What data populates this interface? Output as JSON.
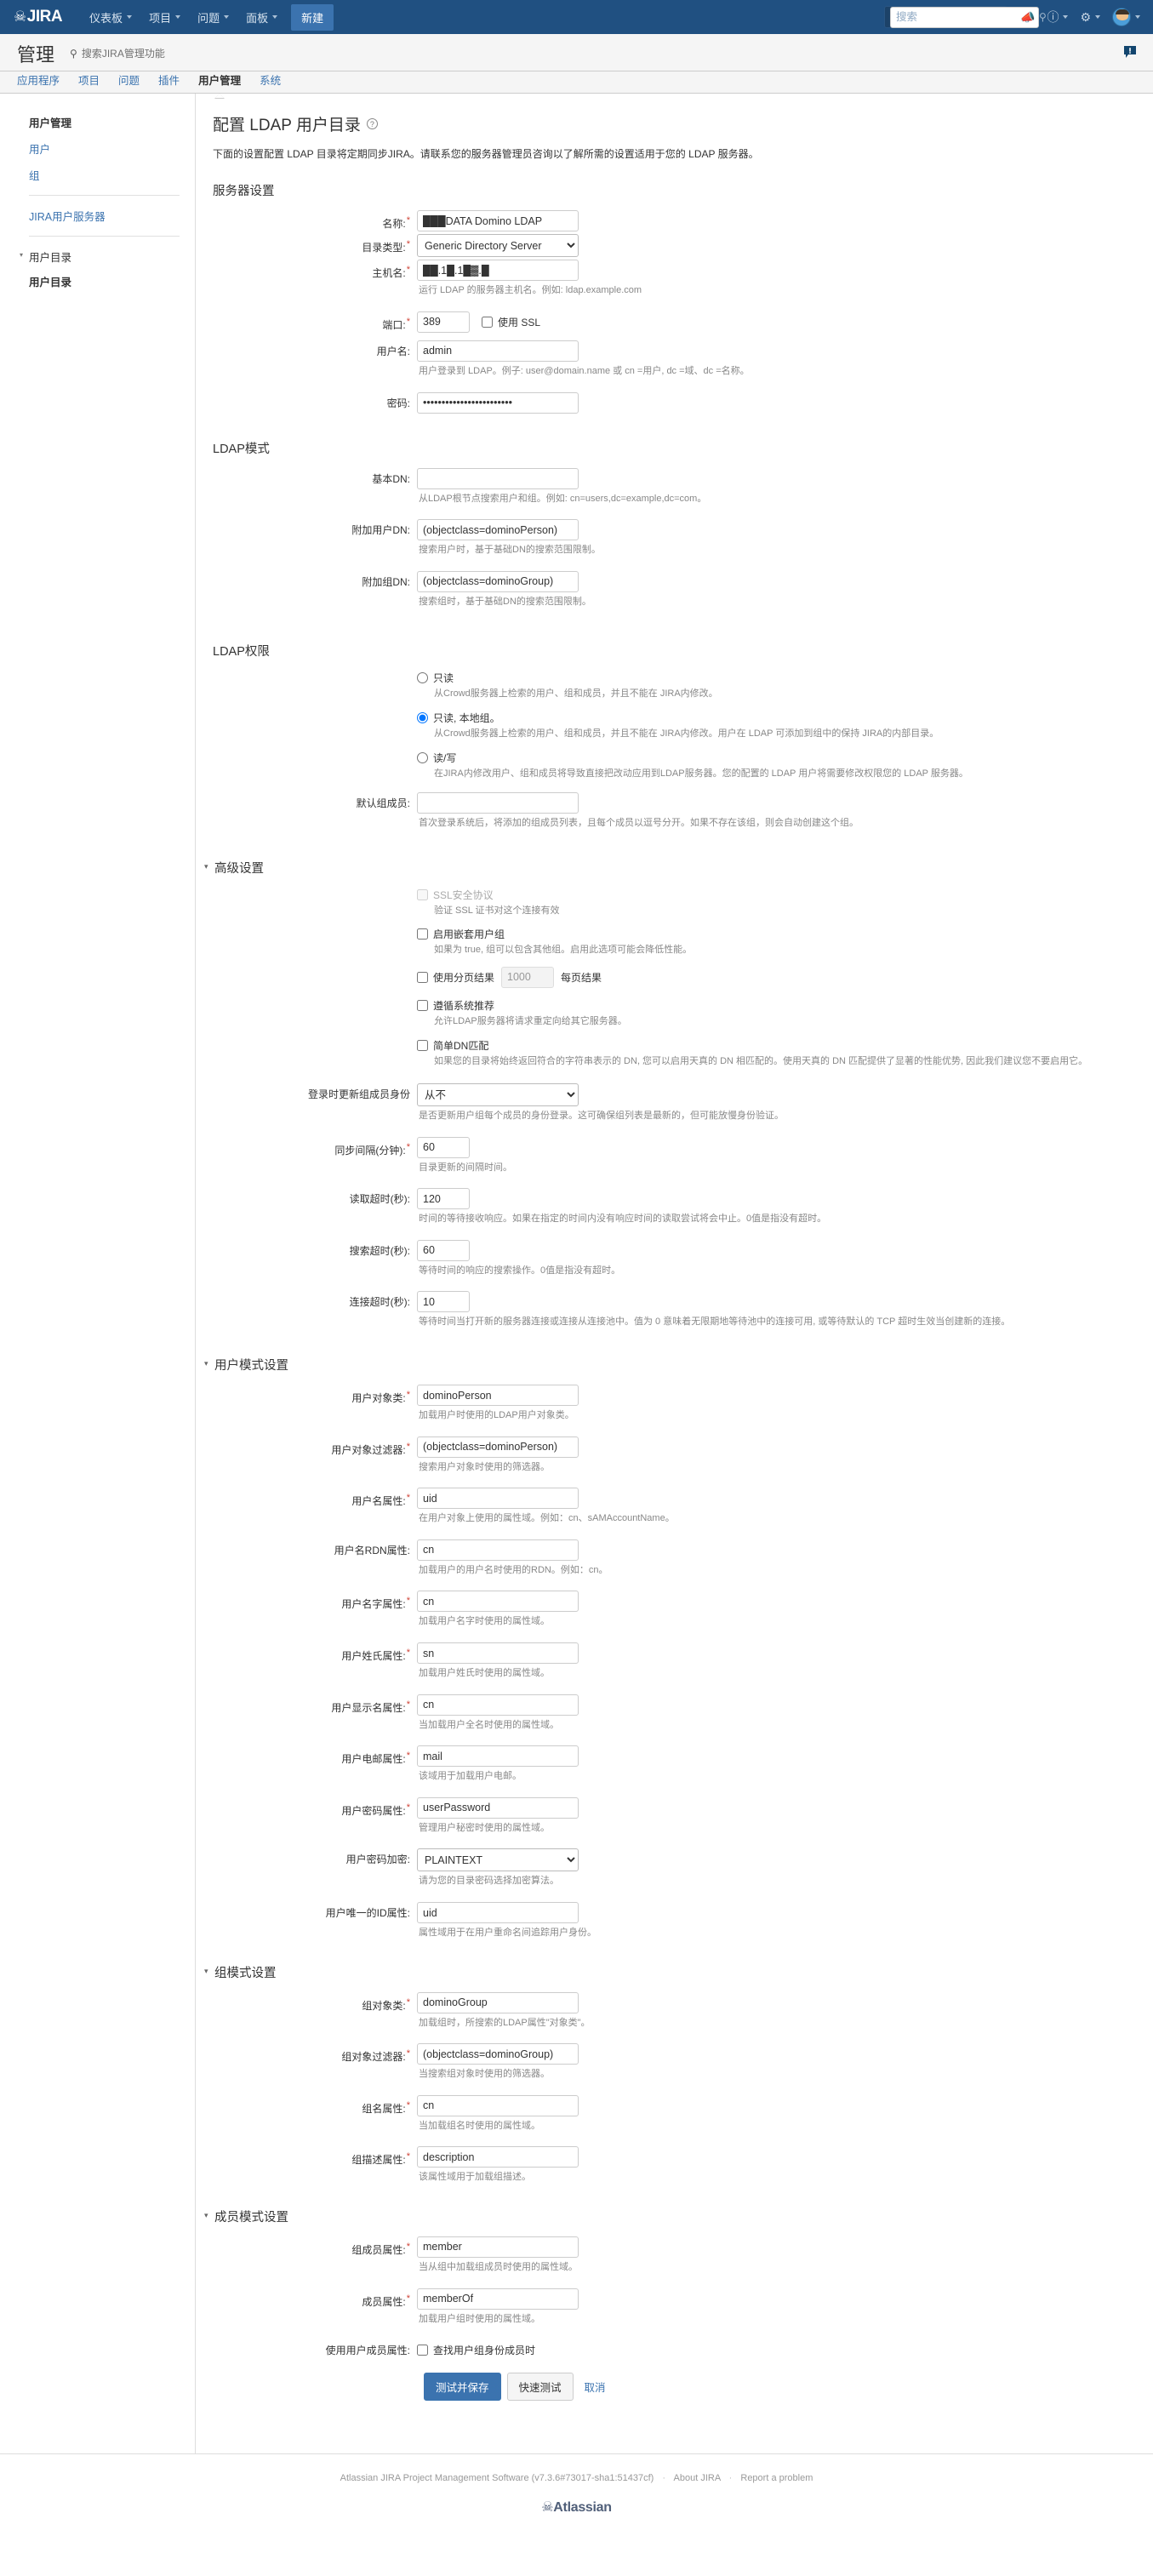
{
  "topnav": {
    "logo": "JIRA",
    "items": [
      {
        "label": "仪表板",
        "caret": true
      },
      {
        "label": "项目",
        "caret": true
      },
      {
        "label": "问题",
        "caret": true
      },
      {
        "label": "面板",
        "caret": true
      }
    ],
    "create_button": "新建",
    "search_placeholder": "搜索",
    "icons": [
      "megaphone-icon",
      "help-icon",
      "gear-icon",
      "avatar"
    ]
  },
  "admin_header": {
    "title": "管理",
    "search_placeholder": "搜索JIRA管理功能",
    "feedback_icon": "feedback-speech-bubble-icon"
  },
  "admin_tabs": [
    {
      "label": "应用程序",
      "active": false
    },
    {
      "label": "项目",
      "active": false
    },
    {
      "label": "问题",
      "active": false
    },
    {
      "label": "插件",
      "active": false
    },
    {
      "label": "用户管理",
      "active": true
    },
    {
      "label": "系统",
      "active": false
    }
  ],
  "sidebar": {
    "group1_head": "用户管理",
    "group1_links": [
      "用户",
      "组"
    ],
    "group2_links": [
      "JIRA用户服务器"
    ],
    "group3_label": "用户目录",
    "group3_current": "用户目录"
  },
  "main": {
    "title": "配置 LDAP 用户目录",
    "description": "下面的设置配置 LDAP 目录将定期同步JIRA。请联系您的服务器管理员咨询以了解所需的设置适用于您的 LDAP 服务器。",
    "sections": {
      "server": "服务器设置",
      "schema": "LDAP模式",
      "permissions": "LDAP权限",
      "advanced": "高级设置",
      "user_schema": "用户模式设置",
      "group_schema": "组模式设置",
      "membership_schema": "成员模式设置"
    },
    "server_settings": {
      "name_label": "名称:",
      "name_value": "███DATA Domino LDAP",
      "dir_type_label": "目录类型:",
      "dir_type_value": "Generic Directory Server",
      "hostname_label": "主机名:",
      "hostname_value": "██.1█.1█▓.█",
      "hostname_help": "运行 LDAP 的服务器主机名。例如: ldap.example.com",
      "port_label": "端口:",
      "port_value": "389",
      "ssl_checkbox_label": "使用 SSL",
      "username_label": "用户名:",
      "username_value": "admin",
      "username_help": "用户登录到 LDAP。例子: user@domain.name 或 cn =用户, dc =域、dc =名称。",
      "password_label": "密码:",
      "password_value": "••••••••••••••••••••••••"
    },
    "ldap_schema": {
      "base_dn_label": "基本DN:",
      "base_dn_value": "",
      "base_dn_help": "从LDAP根节点搜索用户和组。例如: cn=users,dc=example,dc=com。",
      "user_dn_label": "附加用户DN:",
      "user_dn_value": "(objectclass=dominoPerson)",
      "user_dn_help": "搜索用户时，基于基础DN的搜索范围限制。",
      "group_dn_label": "附加组DN:",
      "group_dn_value": "(objectclass=dominoGroup)",
      "group_dn_help": "搜索组时，基于基础DN的搜索范围限制。"
    },
    "ldap_permissions": {
      "opt1_label": "只读",
      "opt1_desc": "从Crowd服务器上检索的用户、组和成员，并且不能在 JIRA内修改。",
      "opt2_label": "只读, 本地组。",
      "opt2_desc": "从Crowd服务器上检索的用户、组和成员，并且不能在 JIRA内修改。用户在 LDAP 可添加到组中的保持 JIRA的内部目录。",
      "opt3_label": "读/写",
      "opt3_desc": "在JIRA内修改用户、组和成员将导致直接把改动应用到LDAP服务器。您的配置的 LDAP 用户将需要修改权限您的 LDAP 服务器。",
      "selected": 2,
      "default_group_label": "默认组成员:",
      "default_group_value": "",
      "default_group_help": "首次登录系统后，将添加的组成员列表，且每个成员以逗号分开。如果不存在该组，则会自动创建这个组。"
    },
    "advanced": {
      "ssl_protocol_label": "SSL安全协议",
      "ssl_protocol_desc": "验证 SSL 证书对这个连接有效",
      "ssl_protocol_checked": false,
      "ssl_protocol_disabled": true,
      "nested_groups_label": "启用嵌套用户组",
      "nested_groups_desc": "如果为 true, 组可以包含其他组。启用此选项可能会降低性能。",
      "nested_groups_checked": false,
      "paged_label": "使用分页结果",
      "paged_value": "1000",
      "paged_suffix": "每页结果",
      "paged_checked": false,
      "referrals_label": "遵循系统推荐",
      "referrals_desc": "允许LDAP服务器将请求重定向给其它服务器。",
      "referrals_checked": false,
      "naive_dn_label": "简单DN匹配",
      "naive_dn_desc": "如果您的目录将始终返回符合的字符串表示的 DN, 您可以启用天真的 DN 相匹配的。使用天真的 DN 匹配提供了显著的性能优势, 因此我们建议您不要启用它。",
      "naive_dn_checked": false,
      "sync_groups_label": "登录时更新组成员身份",
      "sync_groups_value": "从不",
      "sync_groups_help": "是否更新用户组每个成员的身份登录。这可确保组列表是最新的，但可能放慢身份验证。",
      "sync_interval_label": "同步间隔(分钟):",
      "sync_interval_value": "60",
      "sync_interval_help": "目录更新的间隔时间。",
      "read_timeout_label": "读取超时(秒):",
      "read_timeout_value": "120",
      "read_timeout_help": "时间的等待接收响应。如果在指定的时间内没有响应时间的读取尝试将会中止。0值是指没有超时。",
      "search_timeout_label": "搜索超时(秒):",
      "search_timeout_value": "60",
      "search_timeout_help": "等待时间的响应的搜索操作。0值是指没有超时。",
      "connect_timeout_label": "连接超时(秒):",
      "connect_timeout_value": "10",
      "connect_timeout_help": "等待时间当打开新的服务器连接或连接从连接池中。值为 0 意味着无限期地等待池中的连接可用, 或等待默认的 TCP 超时生效当创建新的连接。"
    },
    "user_schema": {
      "object_class_label": "用户对象类:",
      "object_class_value": "dominoPerson",
      "object_class_help": "加载用户时使用的LDAP用户对象类。",
      "object_filter_label": "用户对象过滤器:",
      "object_filter_value": "(objectclass=dominoPerson)",
      "object_filter_help": "搜索用户对象时使用的筛选器。",
      "name_attr_label": "用户名属性:",
      "name_attr_value": "uid",
      "name_attr_help": "在用户对象上使用的属性域。例如：cn、sAMAccountName。",
      "rdn_attr_label": "用户名RDN属性:",
      "rdn_attr_value": "cn",
      "rdn_attr_help": "加载用户的用户名时使用的RDN。例如：cn。",
      "first_name_label": "用户名字属性:",
      "first_name_value": "cn",
      "first_name_help": "加载用户名字时使用的属性域。",
      "last_name_label": "用户姓氏属性:",
      "last_name_value": "sn",
      "last_name_help": "加载用户姓氏时使用的属性域。",
      "display_name_label": "用户显示名属性:",
      "display_name_value": "cn",
      "display_name_help": "当加载用户全名时使用的属性域。",
      "email_label": "用户电邮属性:",
      "email_value": "mail",
      "email_help": "该域用于加载用户电邮。",
      "password_attr_label": "用户密码属性:",
      "password_attr_value": "userPassword",
      "password_attr_help": "管理用户秘密时使用的属性域。",
      "password_enc_label": "用户密码加密:",
      "password_enc_value": "PLAINTEXT",
      "password_enc_help": "请为您的目录密码选择加密算法。",
      "unique_id_label": "用户唯一的ID属性:",
      "unique_id_value": "uid",
      "unique_id_help": "属性域用于在用户重命名间追踪用户身份。"
    },
    "group_schema": {
      "object_class_label": "组对象类:",
      "object_class_value": "dominoGroup",
      "object_class_help": "加载组时，所搜索的LDAP属性\"对象类\"。",
      "object_filter_label": "组对象过滤器:",
      "object_filter_value": "(objectclass=dominoGroup)",
      "object_filter_help": "当搜索组对象时使用的筛选器。",
      "name_attr_label": "组名属性:",
      "name_attr_value": "cn",
      "name_attr_help": "当加载组名时使用的属性域。",
      "desc_attr_label": "组描述属性:",
      "desc_attr_value": "description",
      "desc_attr_help": "该属性域用于加载组描述。"
    },
    "membership_schema": {
      "group_members_label": "组成员属性:",
      "group_members_value": "member",
      "group_members_help": "当从组中加载组成员时使用的属性域。",
      "member_of_label": "成员属性:",
      "member_of_value": "memberOf",
      "member_of_help": "加载用户组时使用的属性域。",
      "use_member_label": "使用用户成员属性:",
      "use_member_checkbox_label": "查找用户组身份成员时",
      "use_member_checked": false
    },
    "buttons": {
      "save": "测试并保存",
      "quick_test": "快速测试",
      "cancel": "取消"
    }
  },
  "footer": {
    "product": "Atlassian JIRA Project Management Software (v7.3.6#73017-sha1:51437cf)",
    "about": "About JIRA",
    "report": "Report a problem",
    "logo": "Atlassian"
  },
  "colors": {
    "nav_blue": "#205081",
    "link_blue": "#3b73af",
    "required_red": "#d04437",
    "button_blue": "#3b73af"
  }
}
